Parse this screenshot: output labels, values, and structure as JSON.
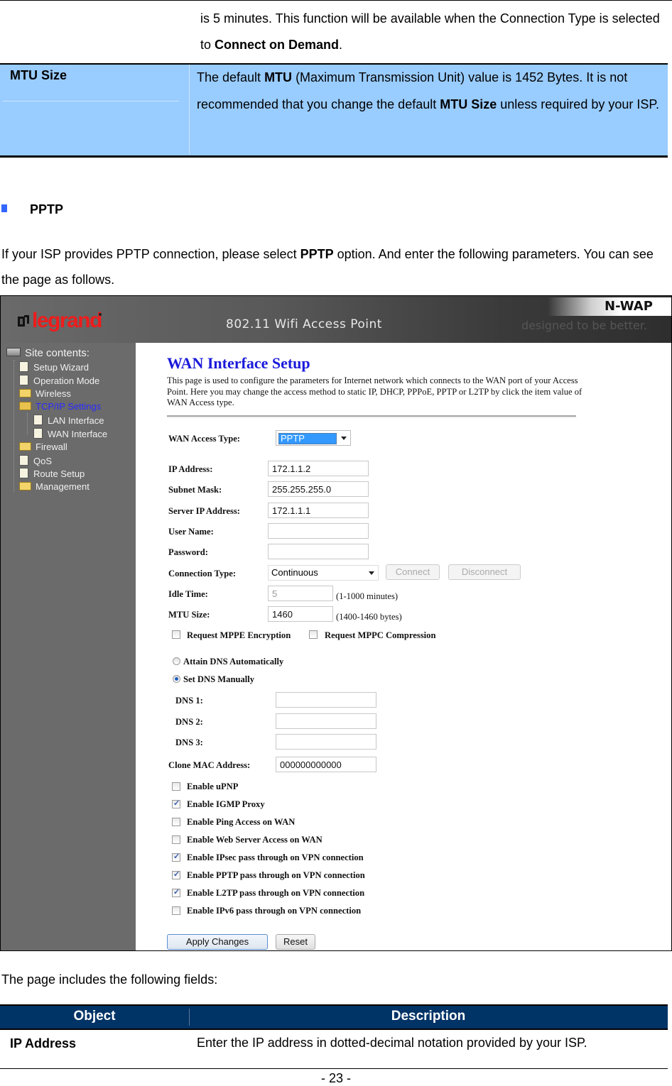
{
  "top_row": {
    "continuation_pre": "is 5 minutes. This function will be available when the Connection Type is selected to ",
    "continuation_bold": "Connect on Demand",
    "continuation_post": "."
  },
  "mtu_row": {
    "name": "MTU Size",
    "desc_1": "The default ",
    "desc_b1": "MTU",
    "desc_2": " (Maximum Transmission Unit) value is 1452 Bytes. It is not recommended that you change the default ",
    "desc_b2": "MTU Size",
    "desc_3": " unless required by your ISP."
  },
  "section": {
    "heading": "PPTP",
    "bullet_color": "#3366ff",
    "para_1": "If your ISP provides PPTP connection, please select ",
    "para_bold": "PPTP",
    "para_2": " option. And enter the following parameters. You can see the page as follows."
  },
  "screenshot": {
    "header": {
      "brand": "legrand",
      "title": "802.11 Wifi Access Point",
      "product": "N-WAP",
      "tagline": "designed to be better.",
      "brand_color": "#ee1c1c"
    },
    "sidebar": {
      "root": "Site contents:",
      "items": [
        {
          "label": "Setup Wizard",
          "icon": "document-icon",
          "level": 1
        },
        {
          "label": "Operation Mode",
          "icon": "document-icon",
          "level": 1
        },
        {
          "label": "Wireless",
          "icon": "folder-icon",
          "level": 1
        },
        {
          "label": "TCP/IP Settings",
          "icon": "folder-open-icon",
          "level": 1,
          "active": true
        },
        {
          "label": "LAN Interface",
          "icon": "document-icon",
          "level": 2
        },
        {
          "label": "WAN Interface",
          "icon": "document-icon",
          "level": 2
        },
        {
          "label": "Firewall",
          "icon": "folder-icon",
          "level": 1
        },
        {
          "label": "QoS",
          "icon": "document-icon",
          "level": 1
        },
        {
          "label": "Route Setup",
          "icon": "document-icon",
          "level": 1
        },
        {
          "label": "Management",
          "icon": "folder-icon",
          "level": 1
        }
      ]
    },
    "main": {
      "title": "WAN Interface Setup",
      "description": "This page is used to configure the parameters for Internet network which connects to the WAN port of your Access Point. Here you may change the access method to static IP, DHCP, PPPoE, PPTP or L2TP by click the item value of WAN Access type.",
      "wan_access_type": {
        "label": "WAN Access Type:",
        "value": "PPTP"
      },
      "ip_address": {
        "label": "IP Address:",
        "value": "172.1.1.2"
      },
      "subnet_mask": {
        "label": "Subnet Mask:",
        "value": "255.255.255.0"
      },
      "server_ip": {
        "label": "Server IP Address:",
        "value": "172.1.1.1"
      },
      "user_name": {
        "label": "User Name:",
        "value": ""
      },
      "password": {
        "label": "Password:",
        "value": ""
      },
      "connection_type": {
        "label": "Connection Type:",
        "value": "Continuous",
        "connect": "Connect",
        "disconnect": "Disconnect"
      },
      "idle_time": {
        "label": "Idle Time:",
        "value": "5",
        "hint": "(1-1000 minutes)"
      },
      "mtu_size": {
        "label": "MTU Size:",
        "value": "1460",
        "hint": "(1400-1460 bytes)"
      },
      "mppe": {
        "label": "Request MPPE Encryption",
        "checked": false
      },
      "mppc": {
        "label": "Request MPPC Compression",
        "checked": false
      },
      "dns_auto": {
        "label": "Attain DNS Automatically",
        "selected": false
      },
      "dns_manual": {
        "label": "Set DNS Manually",
        "selected": true
      },
      "dns1": {
        "label": "DNS 1:",
        "value": ""
      },
      "dns2": {
        "label": "DNS 2:",
        "value": ""
      },
      "dns3": {
        "label": "DNS 3:",
        "value": ""
      },
      "clone_mac": {
        "label": "Clone MAC Address:",
        "value": "000000000000"
      },
      "options": [
        {
          "label": "Enable uPNP",
          "checked": false
        },
        {
          "label": "Enable IGMP Proxy",
          "checked": true
        },
        {
          "label": "Enable Ping Access on WAN",
          "checked": false
        },
        {
          "label": "Enable Web Server Access on WAN",
          "checked": false
        },
        {
          "label": "Enable IPsec pass through on VPN connection",
          "checked": true
        },
        {
          "label": "Enable PPTP pass through on VPN connection",
          "checked": true
        },
        {
          "label": "Enable L2TP pass through on VPN connection",
          "checked": true
        },
        {
          "label": "Enable IPv6 pass through on VPN connection",
          "checked": false
        }
      ],
      "apply_button": "Apply Changes",
      "reset_button": "Reset"
    }
  },
  "fields_intro": "The page includes the following fields:",
  "fields_table": {
    "header_color": "#003366",
    "columns": [
      "Object",
      "Description"
    ],
    "rows": [
      {
        "object": "IP Address",
        "description": "Enter the IP address in dotted-decimal notation provided by your ISP."
      }
    ]
  },
  "page_number": "- 23 -"
}
